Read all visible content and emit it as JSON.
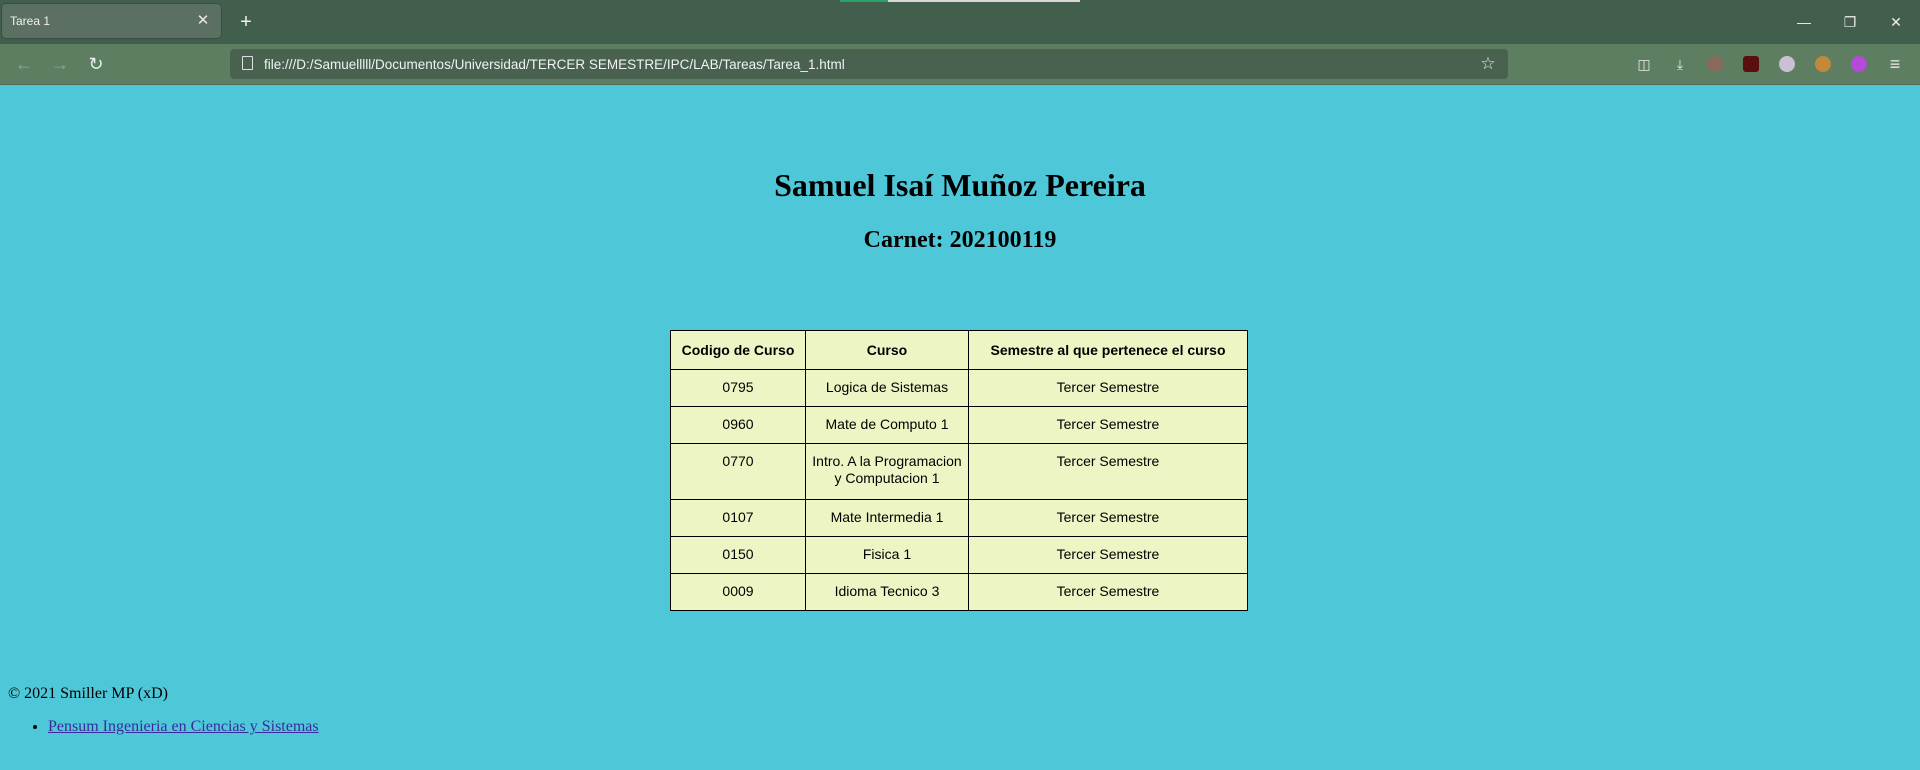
{
  "browser": {
    "tab_title": "Tarea 1",
    "tab_close": "✕",
    "new_tab": "+",
    "url": "file:///D:/Samuelllll/Documentos/Universidad/TERCER SEMESTRE/IPC/LAB/Tareas/Tarea_1.html",
    "window_controls": {
      "minimize": "—",
      "restore": "❐",
      "close": "✕"
    },
    "nav": {
      "back": "←",
      "forward": "→",
      "reload": "↻"
    },
    "bookmark_star": "☆",
    "toolbar_icons": [
      "pocket-icon",
      "download-icon",
      "extension-avatar-icon",
      "extension-red-icon",
      "extension-lock-icon",
      "extension-orange-icon",
      "extension-purple-icon",
      "menu-icon"
    ],
    "toolbar_glyphs": {
      "pocket": "◫",
      "download": "⤓",
      "lock": "🔒",
      "menu": "≡"
    }
  },
  "page": {
    "title": "Samuel Isaí Muñoz Pereira",
    "subtitle": "Carnet: 202100119",
    "table": {
      "headers": [
        "Codigo de Curso",
        "Curso",
        "Semestre al que pertenece el curso"
      ],
      "rows": [
        [
          "0795",
          "Logica de Sistemas",
          "Tercer Semestre"
        ],
        [
          "0960",
          "Mate de Computo 1",
          "Tercer Semestre"
        ],
        [
          "0770",
          "Intro. A la Programacion y Computacion 1",
          "Tercer Semestre"
        ],
        [
          "0107",
          "Mate Intermedia 1",
          "Tercer Semestre"
        ],
        [
          "0150",
          "Fisica 1",
          "Tercer Semestre"
        ],
        [
          "0009",
          "Idioma Tecnico 3",
          "Tercer Semestre"
        ]
      ]
    },
    "footer": "© 2021 Smiller MP (xD)",
    "links": [
      "Pensum Ingenieria en Ciencias y Sistemas"
    ]
  },
  "colors": {
    "page_background": "#4ec8d8",
    "table_background": "#eef5c4",
    "tab_strip": "#425e4d",
    "toolbar": "#5e7e62",
    "link": "#3b2a9e"
  }
}
